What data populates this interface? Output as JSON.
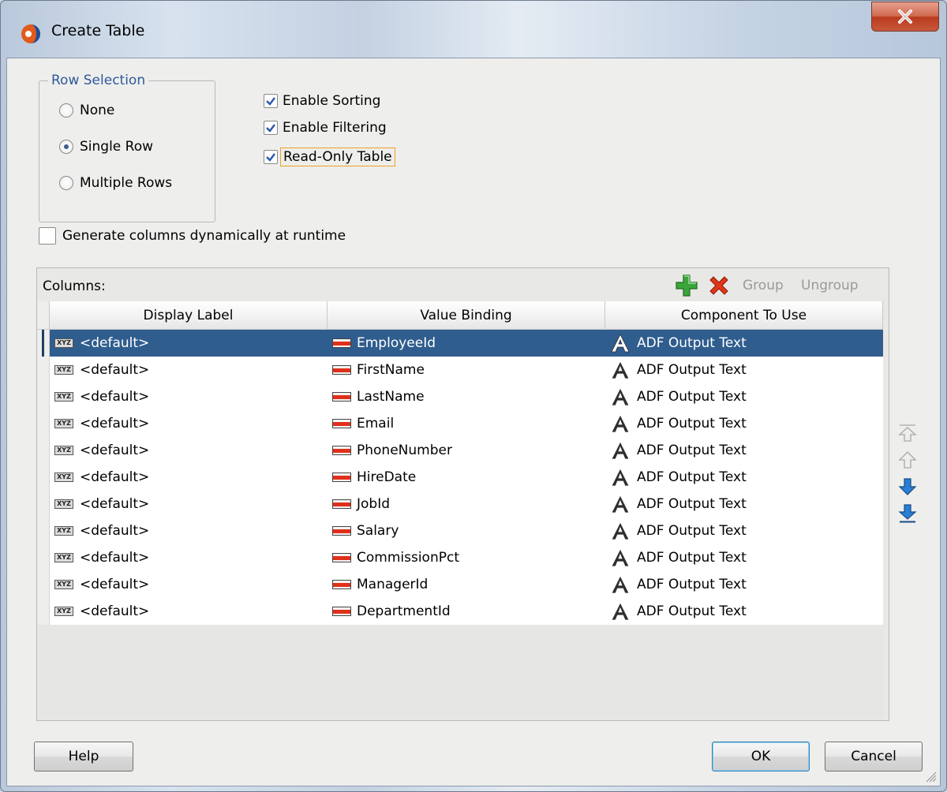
{
  "window": {
    "title": "Create Table",
    "close_label": "X"
  },
  "row_selection": {
    "legend": "Row Selection",
    "options": [
      {
        "label": "None",
        "checked": false
      },
      {
        "label": "Single Row",
        "checked": true
      },
      {
        "label": "Multiple Rows",
        "checked": false
      }
    ]
  },
  "options": {
    "enable_sorting": "Enable Sorting",
    "enable_filtering": "Enable Filtering",
    "read_only": "Read-Only Table",
    "generate_dynamic": "Generate columns dynamically at runtime"
  },
  "columns": {
    "label": "Columns:",
    "toolbar": {
      "group": "Group",
      "ungroup": "Ungroup"
    },
    "headers": [
      "Display Label",
      "Value Binding",
      "Component To Use"
    ],
    "rows": [
      {
        "label": "<default>",
        "binding": "EmployeeId",
        "component": "ADF Output Text",
        "selected": true
      },
      {
        "label": "<default>",
        "binding": "FirstName",
        "component": "ADF Output Text"
      },
      {
        "label": "<default>",
        "binding": "LastName",
        "component": "ADF Output Text"
      },
      {
        "label": "<default>",
        "binding": "Email",
        "component": "ADF Output Text"
      },
      {
        "label": "<default>",
        "binding": "PhoneNumber",
        "component": "ADF Output Text"
      },
      {
        "label": "<default>",
        "binding": "HireDate",
        "component": "ADF Output Text"
      },
      {
        "label": "<default>",
        "binding": "JobId",
        "component": "ADF Output Text"
      },
      {
        "label": "<default>",
        "binding": "Salary",
        "component": "ADF Output Text"
      },
      {
        "label": "<default>",
        "binding": "CommissionPct",
        "component": "ADF Output Text"
      },
      {
        "label": "<default>",
        "binding": "ManagerId",
        "component": "ADF Output Text"
      },
      {
        "label": "<default>",
        "binding": "DepartmentId",
        "component": "ADF Output Text"
      }
    ]
  },
  "icons": {
    "display_label": "xyz-text-icon",
    "value_binding": "attribute-icon",
    "component": "output-text-icon",
    "xyz_text": "XYZ"
  },
  "buttons": {
    "help": "Help",
    "ok": "OK",
    "cancel": "Cancel"
  },
  "colors": {
    "selection": "#2f5d8e",
    "legend": "#2d5a9a",
    "add": "#3aa53a",
    "delete": "#e0361a",
    "arrow_active": "#2a7fd4"
  }
}
